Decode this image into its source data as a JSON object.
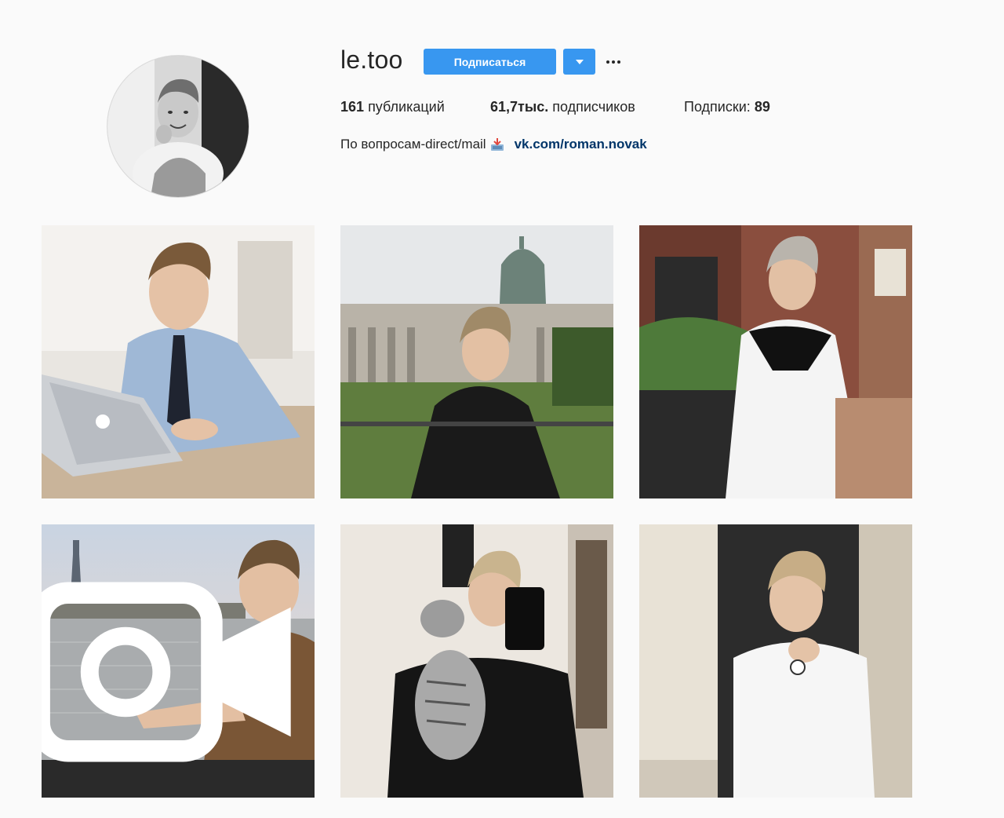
{
  "profile": {
    "username": "le.too",
    "follow_label": "Подписаться",
    "avatar_icon": "profile-photo"
  },
  "stats": {
    "posts_count": "161",
    "posts_label": "публикаций",
    "followers_count": "61,7тыс.",
    "followers_label": "подписчиков",
    "following_label": "Подписки:",
    "following_count": "89"
  },
  "bio": {
    "text": "По вопросам-direct/mail",
    "emoji_icon": "inbox-tray-icon",
    "link": "vk.com/roman.novak"
  },
  "posts": [
    {
      "icon": "photo",
      "video": false
    },
    {
      "icon": "photo",
      "video": false
    },
    {
      "icon": "photo",
      "video": false
    },
    {
      "icon": "photo",
      "video": true
    },
    {
      "icon": "photo",
      "video": false
    },
    {
      "icon": "photo",
      "video": false
    }
  ],
  "colors": {
    "accent": "#3897f0",
    "link": "#003569",
    "background": "#fafafa"
  }
}
